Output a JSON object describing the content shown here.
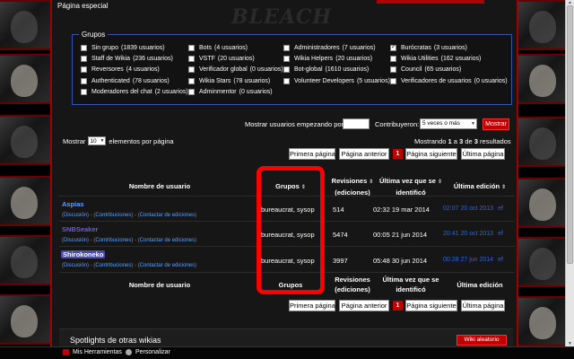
{
  "page": {
    "title": "Página especial"
  },
  "groups": {
    "legend": "Grupos",
    "items": [
      {
        "label": "Sin grupo",
        "count": "(1839 usuarios)",
        "checked": false
      },
      {
        "label": "Staff de Wikia",
        "count": "(236 usuarios)",
        "checked": false
      },
      {
        "label": "Reversores",
        "count": "(4 usuarios)",
        "checked": false
      },
      {
        "label": "Authenticated",
        "count": "(78 usuarios)",
        "checked": false
      },
      {
        "label": "Moderadores del chat",
        "count": "(2 usuarios)",
        "checked": false
      },
      {
        "label": "Bots",
        "count": "(4 usuarios)",
        "checked": false
      },
      {
        "label": "VSTF",
        "count": "(20 usuarios)",
        "checked": false
      },
      {
        "label": "Verificador global",
        "count": "(0 usuarios)",
        "checked": false
      },
      {
        "label": "Wikia Stars",
        "count": "(78 usuarios)",
        "checked": false
      },
      {
        "label": "Adminmentor",
        "count": "(0 usuarios)",
        "checked": false
      },
      {
        "label": "Administradores",
        "count": "(7 usuarios)",
        "checked": false
      },
      {
        "label": "Wikia Helpers",
        "count": "(20 usuarios)",
        "checked": false
      },
      {
        "label": "Bot-global",
        "count": "(1610 usuarios)",
        "checked": false
      },
      {
        "label": "Volunteer Developers",
        "count": "(5 usuarios)",
        "checked": false
      },
      {
        "label": "Burócratas",
        "count": "(3 usuarios)",
        "checked": true
      },
      {
        "label": "Wikia Utilities",
        "count": "(162 usuarios)",
        "checked": false
      },
      {
        "label": "Council",
        "count": "(65 usuarios)",
        "checked": false
      },
      {
        "label": "Verificadores de usuarios",
        "count": "(0 usuarios)",
        "checked": false
      }
    ]
  },
  "filter": {
    "start_label": "Mostrar usuarios empezando por:",
    "start_value": "",
    "contrib_label": "Contribuyeron:",
    "contrib_value": "5 veces o más",
    "submit_label": "Mostrar"
  },
  "listing": {
    "show_label": "Mostrar",
    "per_page": "10",
    "per_page_suffix": "elementos por página",
    "results_prefix": "Mostrando",
    "results_from": "1",
    "results_mid1": "a",
    "results_to": "3",
    "results_mid2": "de",
    "results_total": "3",
    "results_suffix": "resultados"
  },
  "pager": {
    "first": "Primera página",
    "prev": "Página anterior",
    "current": "1",
    "next": "Página siguiente",
    "last": "Última página"
  },
  "table": {
    "headers": {
      "username": "Nombre de usuario",
      "groups": "Grupos",
      "revisions_line1": "Revisiones",
      "revisions_line2": "(ediciones)",
      "last_seen_line1": "Última vez que se",
      "last_seen_line2": "identificó",
      "last_edit": "Última edición"
    },
    "sublinks": {
      "open": "(",
      "discussion": "Discusión",
      "sep1": ") - (",
      "contributions": "Contribuciones",
      "sep2": ") - (",
      "contact": "Contactar de ediciones",
      "close": ")"
    },
    "rows": [
      {
        "user": "Aspias",
        "groups": "bureaucrat, sysop",
        "revisions": "514",
        "last_seen": "02:32 19 mar 2014",
        "last_edit": "02:07 20 oct 2013",
        "edit_link": "ef"
      },
      {
        "user": "SNBSeaker",
        "groups": "bureaucrat, sysop",
        "revisions": "5474",
        "last_seen": "00:05 21 jun 2014",
        "last_edit": "20:41 20 oct 2013",
        "edit_link": "ef"
      },
      {
        "user": "Shirokoneko",
        "groups": "bureaucrat, sysop",
        "revisions": "3997",
        "last_seen": "05:48 30 jun 2014",
        "last_edit": "00:28 27 jun 2014",
        "edit_link": "ef"
      }
    ]
  },
  "spotlights": {
    "title": "Spotlights de otras wikias",
    "random_label": "Wiki aleatorio"
  },
  "toolbar": {
    "tools_label": "Mis Herramientas",
    "customize_label": "Personalizar"
  },
  "colors": {
    "accent_red": "#c00000",
    "link_blue": "#5aa0ff",
    "annotation": "#ff0000"
  }
}
